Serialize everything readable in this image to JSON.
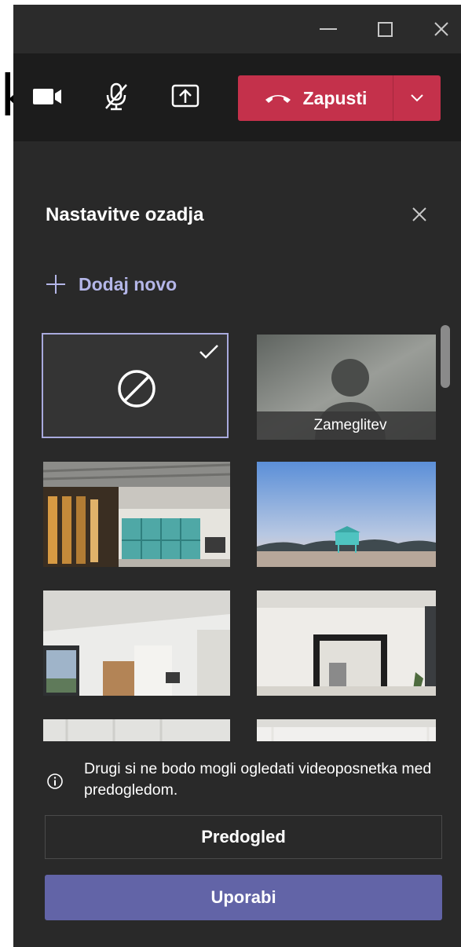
{
  "background_partial_text": "k",
  "titlebar": {
    "minimize_icon": "minimize-icon",
    "maximize_icon": "maximize-icon",
    "close_icon": "close-icon"
  },
  "toolbar": {
    "camera_icon": "video-camera-icon",
    "mic_icon": "microphone-muted-icon",
    "share_icon": "share-screen-icon",
    "hangup_label": "Zapusti",
    "hangup_icon": "phone-hangup-icon",
    "hangup_color": "#c4314b"
  },
  "panel": {
    "title": "Nastavitve ozadja",
    "add_new_label": "Dodaj novo",
    "backgrounds": [
      {
        "type": "none",
        "selected": true,
        "icon": "no-background-icon"
      },
      {
        "type": "blur",
        "caption": "Zameglitev",
        "selected": false
      },
      {
        "type": "image",
        "theme": "office",
        "selected": false
      },
      {
        "type": "image",
        "theme": "beach",
        "selected": false
      },
      {
        "type": "image",
        "theme": "white-room",
        "selected": false
      },
      {
        "type": "image",
        "theme": "room-with-mirror",
        "selected": false
      },
      {
        "type": "image",
        "theme": "white-interior",
        "selected": false
      },
      {
        "type": "image",
        "theme": "white-interior",
        "selected": false
      }
    ],
    "info_text": "Drugi si ne bodo mogli ogledati videoposnetka med predogledom.",
    "preview_label": "Predogled",
    "apply_label": "Uporabi",
    "accent_color": "#6264a7"
  }
}
